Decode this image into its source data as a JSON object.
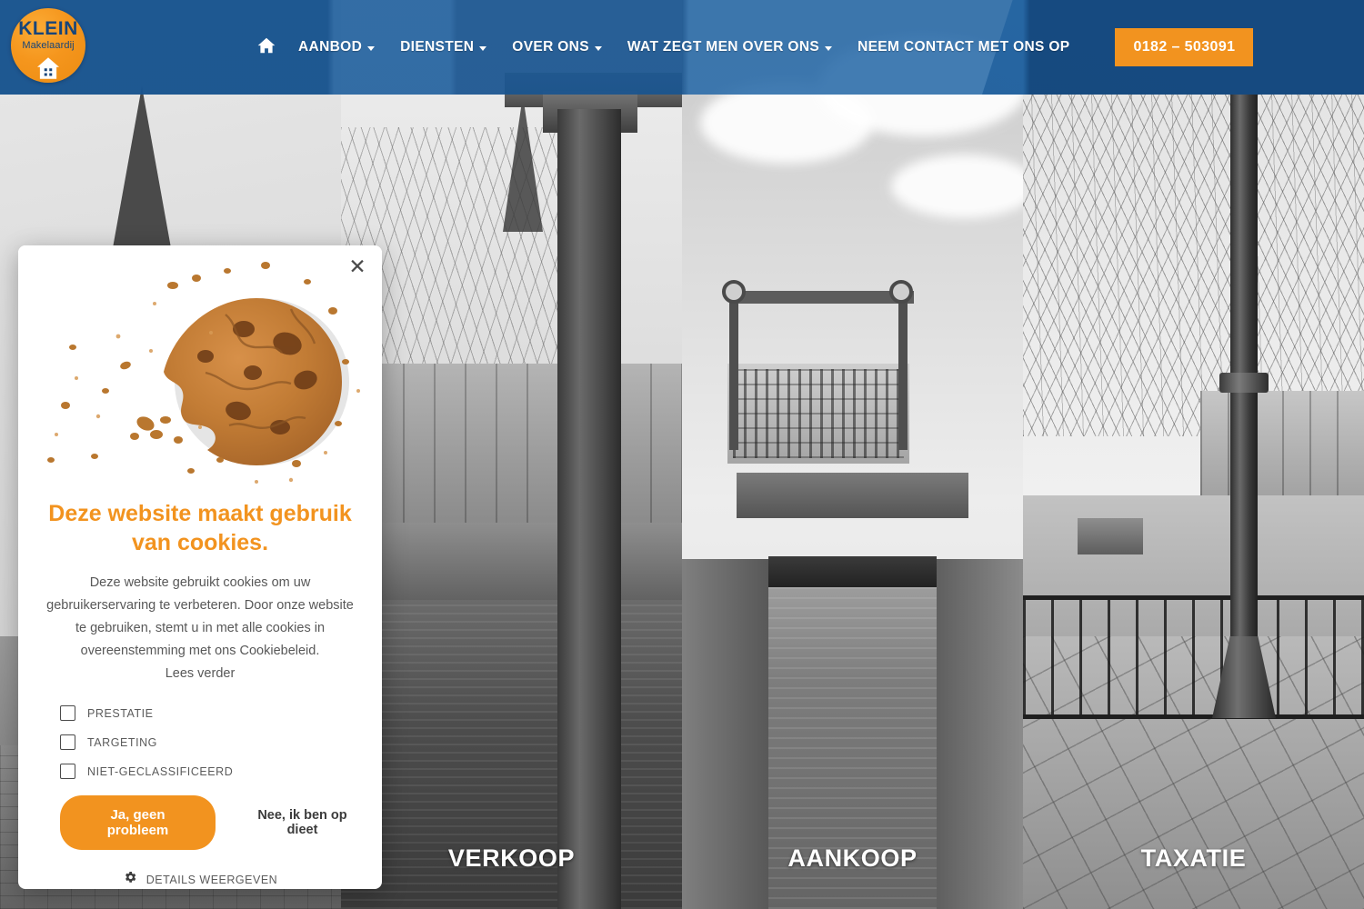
{
  "brand": {
    "logo_line1": "KLEIN",
    "logo_line2": "Makelaardij",
    "logo_icon": "house-icon",
    "accent_orange": "#F2931F",
    "header_blue": "#18538E",
    "logo_text_blue": "#17457A"
  },
  "header": {
    "home_icon": "home-icon",
    "nav": [
      {
        "label": "AANBOD",
        "has_dropdown": true
      },
      {
        "label": "DIENSTEN",
        "has_dropdown": true
      },
      {
        "label": "OVER ONS",
        "has_dropdown": true
      },
      {
        "label": "WAT ZEGT MEN OVER ONS",
        "has_dropdown": true
      },
      {
        "label": "NEEM CONTACT MET ONS OP",
        "has_dropdown": false
      }
    ],
    "phone_label": "0182 – 503091"
  },
  "hero": {
    "panels": [
      {
        "caption": "",
        "scene": "church-spire-bw"
      },
      {
        "caption": "VERKOOP",
        "scene": "canal-column-bw"
      },
      {
        "caption": "AANKOOP",
        "scene": "lock-bridge-bw"
      },
      {
        "caption": "TAXATIE",
        "scene": "lamppost-railing-bw"
      }
    ]
  },
  "cookie_dialog": {
    "close_icon": "close-icon",
    "image_alt": "cookie-with-crumbs-photo",
    "title": "Deze website maakt gebruik van cookies.",
    "body": "Deze website gebruikt cookies om uw gebruikerservaring te verbeteren. Door onze website te gebruiken, stemt u in met alle cookies in overeenstemming met ons Cookiebeleid.",
    "read_more": "Lees verder",
    "categories": [
      {
        "label": "PRESTATIE",
        "checked": false
      },
      {
        "label": "TARGETING",
        "checked": false
      },
      {
        "label": "NIET-GECLASSIFICEERD",
        "checked": false
      }
    ],
    "accept_label": "Ja, geen probleem",
    "decline_label": "Nee, ik ben op dieet",
    "details_icon": "gear-icon",
    "details_label": "DETAILS WEERGEVEN"
  }
}
